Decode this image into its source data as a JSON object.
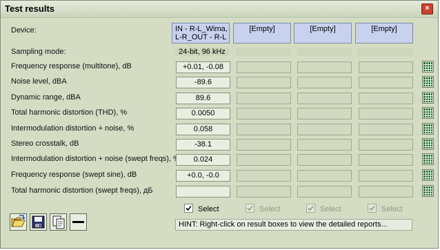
{
  "window": {
    "title": "Test results",
    "close_label": "×"
  },
  "devices": {
    "label": "Device:",
    "items": [
      "IN - R-L_Wima, L-R_OUT - R-L",
      "[Empty]",
      "[Empty]",
      "[Empty]"
    ]
  },
  "sampling": {
    "label": "Sampling mode:",
    "value": "24-bit, 96 kHz"
  },
  "rows": [
    {
      "label": "Frequency response (multitone), dB",
      "value": "+0.01, -0.08"
    },
    {
      "label": "Noise level, dBA",
      "value": "-89.6"
    },
    {
      "label": "Dynamic range, dBA",
      "value": "89.6"
    },
    {
      "label": "Total harmonic distortion (THD), %",
      "value": "0.0050"
    },
    {
      "label": "Intermodulation distortion + noise, %",
      "value": "0.058"
    },
    {
      "label": "Stereo crosstalk, dB",
      "value": "-38.1"
    },
    {
      "label": "Intermodulation distortion + noise (swept freqs), %",
      "value": "0.024"
    },
    {
      "label": "Frequency response (swept sine), dB",
      "value": "+0.0, -0.0"
    },
    {
      "label": "Total harmonic distortion (swept freqs), дБ",
      "value": ""
    }
  ],
  "select_label": "Select",
  "hint": "HINT: Right-click on result boxes to view the detailed reports...",
  "icons": {
    "report": "grid-report-icon",
    "open": "folder-open-icon",
    "save": "floppy-disk-icon",
    "copy": "copy-icon",
    "remove": "minus-icon"
  }
}
